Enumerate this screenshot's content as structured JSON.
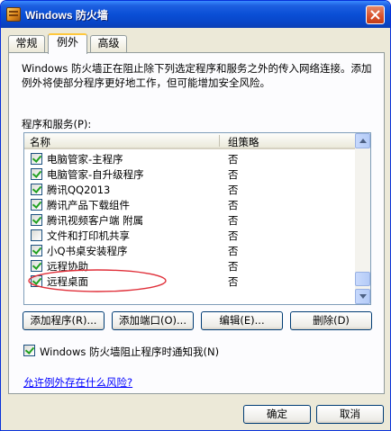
{
  "window": {
    "title": "Windows 防火墙",
    "close_label": "×"
  },
  "tabs": [
    {
      "label": "常规",
      "active": false
    },
    {
      "label": "例外",
      "active": true
    },
    {
      "label": "高级",
      "active": false
    }
  ],
  "exceptions": {
    "description": "Windows 防火墙正在阻止除下列选定程序和服务之外的传入网络连接。添加例外将使部分程序更好地工作，但可能增加安全风险。",
    "list_label": "程序和服务(P):",
    "columns": {
      "name": "名称",
      "policy": "组策略"
    },
    "rows": [
      {
        "name": "电脑管家-主程序",
        "policy": "否",
        "checked": true
      },
      {
        "name": "电脑管家-自升级程序",
        "policy": "否",
        "checked": true
      },
      {
        "name": "腾讯QQ2013",
        "policy": "否",
        "checked": true
      },
      {
        "name": "腾讯产品下载组件",
        "policy": "否",
        "checked": true
      },
      {
        "name": "腾讯视频客户端 附属",
        "policy": "否",
        "checked": true
      },
      {
        "name": "文件和打印机共享",
        "policy": "否",
        "checked": false
      },
      {
        "name": "小Q书桌安装程序",
        "policy": "否",
        "checked": true
      },
      {
        "name": "远程协助",
        "policy": "否",
        "checked": true
      },
      {
        "name": "远程桌面",
        "policy": "否",
        "checked": true
      }
    ],
    "buttons": {
      "add_program": "添加程序(R)...",
      "add_port": "添加端口(O)...",
      "edit": "编辑(E)...",
      "delete": "删除(D)"
    },
    "notify_label": "Windows 防火墙阻止程序时通知我(N)",
    "notify_checked": true,
    "risk_link": "允许例外存在什么风险?"
  },
  "footer": {
    "ok": "确定",
    "cancel": "取消"
  },
  "colors": {
    "annotation": "#e0303a",
    "link": "#0000ff",
    "accent": "#0a4fd6"
  }
}
